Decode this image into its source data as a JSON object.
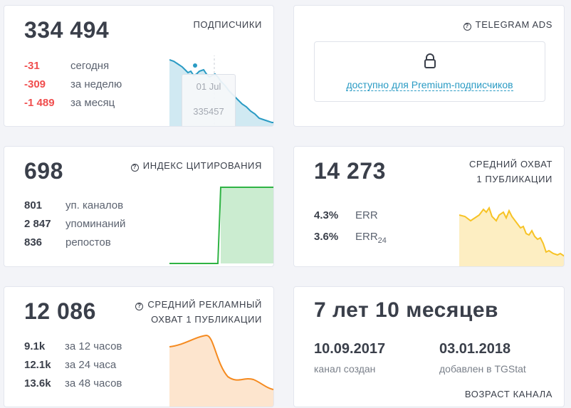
{
  "subscribers": {
    "value": "334 494",
    "title": "ПОДПИСЧИКИ",
    "rows": [
      {
        "value": "-31",
        "label": "сегодня"
      },
      {
        "value": "-309",
        "label": "за неделю"
      },
      {
        "value": "-1 489",
        "label": "за месяц"
      }
    ],
    "tooltip": {
      "date": "01 Jul",
      "value": "335457"
    },
    "color": "#2a9bc4"
  },
  "ads": {
    "title": "TELEGRAM ADS",
    "link": "доступно для Premium-подписчиков",
    "icon": "lock-icon"
  },
  "citation": {
    "value": "698",
    "title": "ИНДЕКС ЦИТИРОВАНИЯ",
    "rows": [
      {
        "value": "801",
        "label": "уп. каналов"
      },
      {
        "value": "2 847",
        "label": "упоминаний"
      },
      {
        "value": "836",
        "label": "репостов"
      }
    ],
    "color": "#2fb344"
  },
  "reach": {
    "value": "14 273",
    "title_line1": "СРЕДНИЙ ОХВАТ",
    "title_line2": "1 ПУБЛИКАЦИИ",
    "err": {
      "value": "4.3%",
      "label": "ERR"
    },
    "err24": {
      "value": "3.6%",
      "label": "ERR",
      "sub": "24"
    },
    "color": "#f7c325"
  },
  "ad_reach": {
    "value": "12 086",
    "title_line1": "СРЕДНИЙ РЕКЛАМНЫЙ",
    "title_line2": "ОХВАТ 1 ПУБЛИКАЦИИ",
    "rows": [
      {
        "value": "9.1k",
        "label": "за 12 часов"
      },
      {
        "value": "12.1k",
        "label": "за 24 часа"
      },
      {
        "value": "13.6k",
        "label": "за 48 часов"
      }
    ],
    "color": "#f58a1f"
  },
  "age": {
    "value": "7 лет 10 месяцев",
    "created_date": "10.09.2017",
    "created_label": "канал создан",
    "added_date": "03.01.2018",
    "added_label": "добавлен в TGStat",
    "title": "ВОЗРАСТ КАНАЛА"
  }
}
